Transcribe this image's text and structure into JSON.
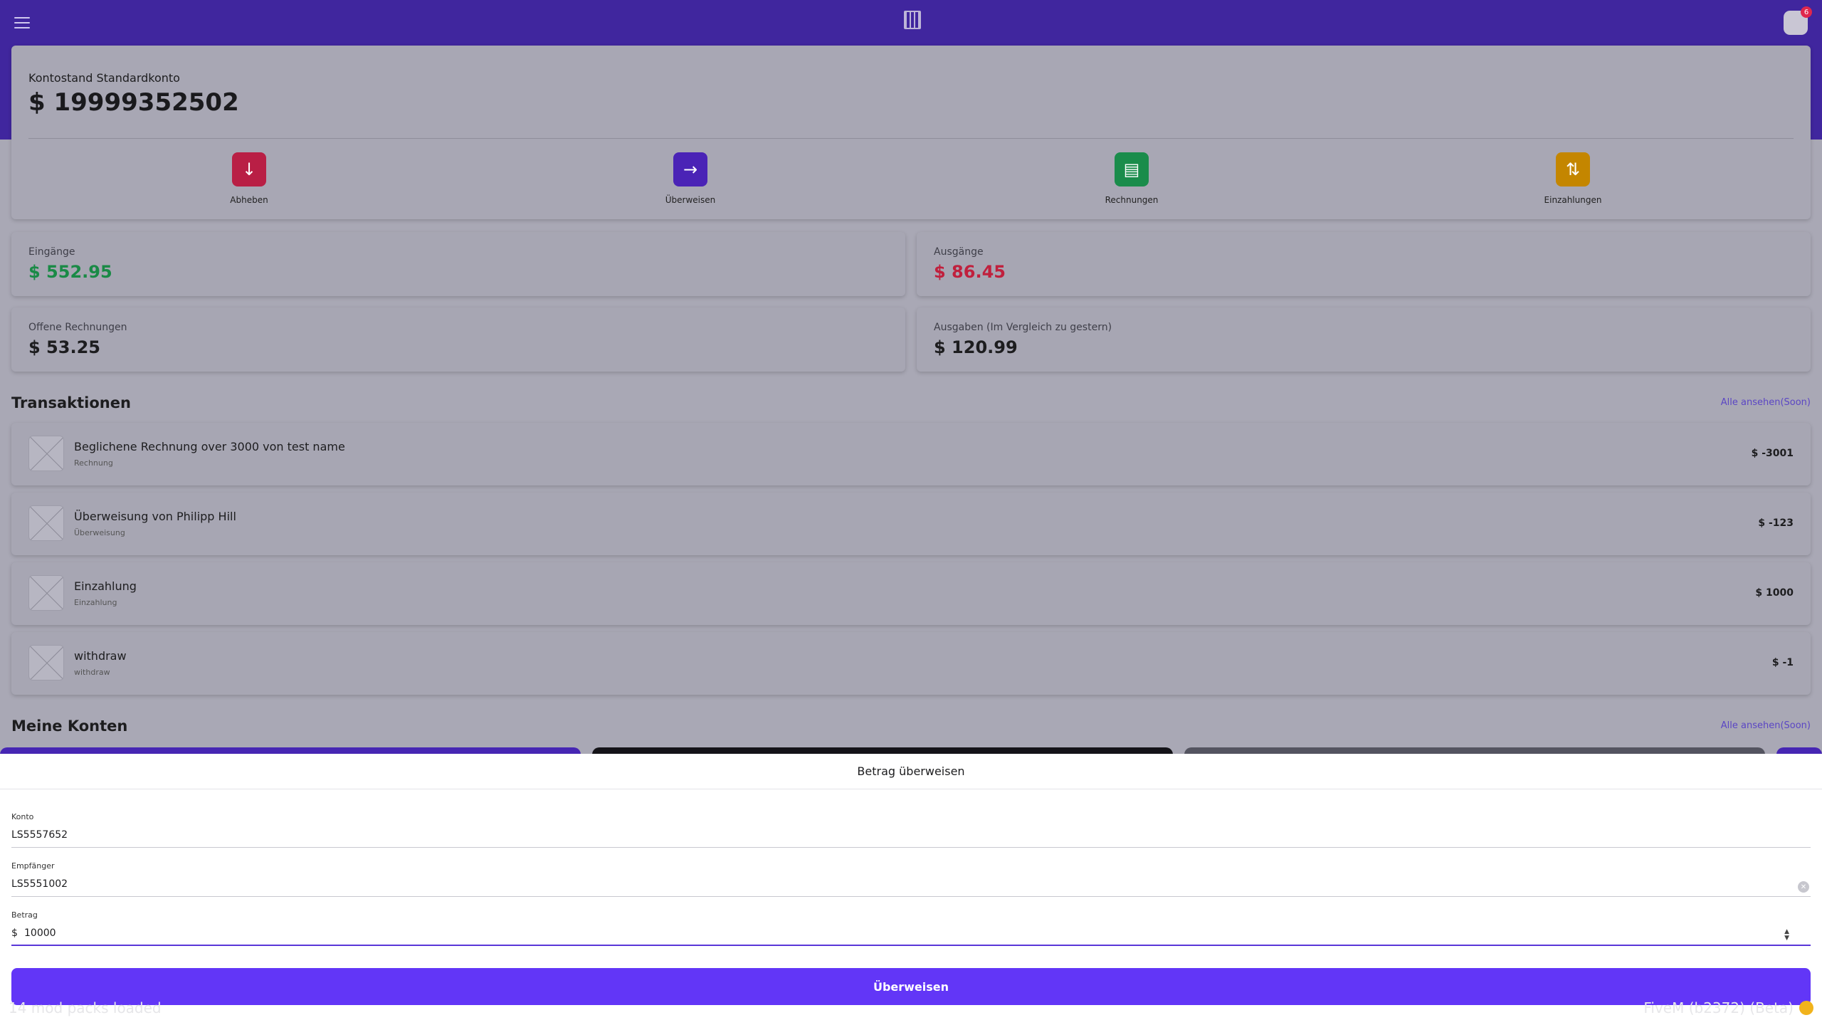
{
  "header": {
    "menu_icon": "hamburger-menu-icon",
    "logo_icon": "bank-logo-icon",
    "notification_count": "6"
  },
  "balance": {
    "label": "Kontostand Standardkonto",
    "value": "$ 19999352502"
  },
  "actions": [
    {
      "label": "Abheben",
      "icon": "arrow-down-icon",
      "color": "#e0244d"
    },
    {
      "label": "Überweisen",
      "icon": "arrow-right-icon",
      "color": "#5b2fd6"
    },
    {
      "label": "Rechnungen",
      "icon": "receipt-icon",
      "color": "#1fae5b"
    },
    {
      "label": "Einzahlungen",
      "icon": "swap-vertical-icon",
      "color": "#f0a300"
    }
  ],
  "stats": [
    {
      "label": "Eingänge",
      "value": "$ 552.95",
      "color": "#1a9a4d"
    },
    {
      "label": "Ausgänge",
      "value": "$ 86.45",
      "color": "#d0203f"
    },
    {
      "label": "Offene Rechnungen",
      "value": "$ 53.25",
      "color": "#1d1d1f"
    },
    {
      "label": "Ausgaben (Im Vergleich zu gestern)",
      "value": "$ 120.99",
      "color": "#1d1d1f"
    }
  ],
  "transactions": {
    "title": "Transaktionen",
    "see_all": "Alle ansehen(Soon)",
    "items": [
      {
        "title": "Beglichene Rechnung over 3000 von test name",
        "subtitle": "Rechnung",
        "amount": "$ -3001"
      },
      {
        "title": "Überweisung von Philipp Hill",
        "subtitle": "Überweisung",
        "amount": "$ -123"
      },
      {
        "title": "Einzahlung",
        "subtitle": "Einzahlung",
        "amount": "$ 1000"
      },
      {
        "title": "withdraw",
        "subtitle": "withdraw",
        "amount": "$ -1"
      }
    ]
  },
  "accounts": {
    "title": "Meine Konten",
    "see_all": "Alle ansehen(Soon)"
  },
  "transfer_sheet": {
    "title": "Betrag überweisen",
    "fields": [
      {
        "label": "Konto",
        "value": "LS5557652"
      },
      {
        "label": "Empfänger",
        "value": "LS5551002"
      },
      {
        "label": "Betrag",
        "prefix": "$",
        "value": "10000"
      }
    ],
    "submit_label": "Überweisen"
  },
  "game_overlay": {
    "left_text": "14 mod packs loaded",
    "right_text": "FiveM (b2372) (Beta)"
  }
}
